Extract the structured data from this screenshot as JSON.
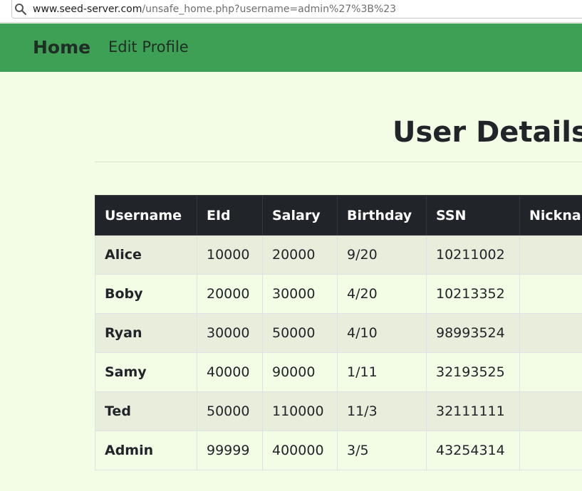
{
  "browser": {
    "url_domain": "www.seed-server.com",
    "url_path": "/unsafe_home.php?username=admin%27%3B%23"
  },
  "nav": {
    "brand": "Home",
    "edit_profile": "Edit Profile"
  },
  "page": {
    "title": "User Details"
  },
  "table": {
    "headers": [
      "Username",
      "EId",
      "Salary",
      "Birthday",
      "SSN",
      "Nickname"
    ],
    "rows": [
      [
        "Alice",
        "10000",
        "20000",
        "9/20",
        "10211002",
        ""
      ],
      [
        "Boby",
        "20000",
        "30000",
        "4/20",
        "10213352",
        ""
      ],
      [
        "Ryan",
        "30000",
        "50000",
        "4/10",
        "98993524",
        ""
      ],
      [
        "Samy",
        "40000",
        "90000",
        "1/11",
        "32193525",
        ""
      ],
      [
        "Ted",
        "50000",
        "110000",
        "11/3",
        "32111111",
        ""
      ],
      [
        "Admin",
        "99999",
        "400000",
        "3/5",
        "43254314",
        ""
      ]
    ]
  },
  "colors": {
    "navbar": "#3ea055",
    "background": "#f3fde6",
    "table_header": "#212529",
    "row_stripe": "#e8eedb"
  }
}
